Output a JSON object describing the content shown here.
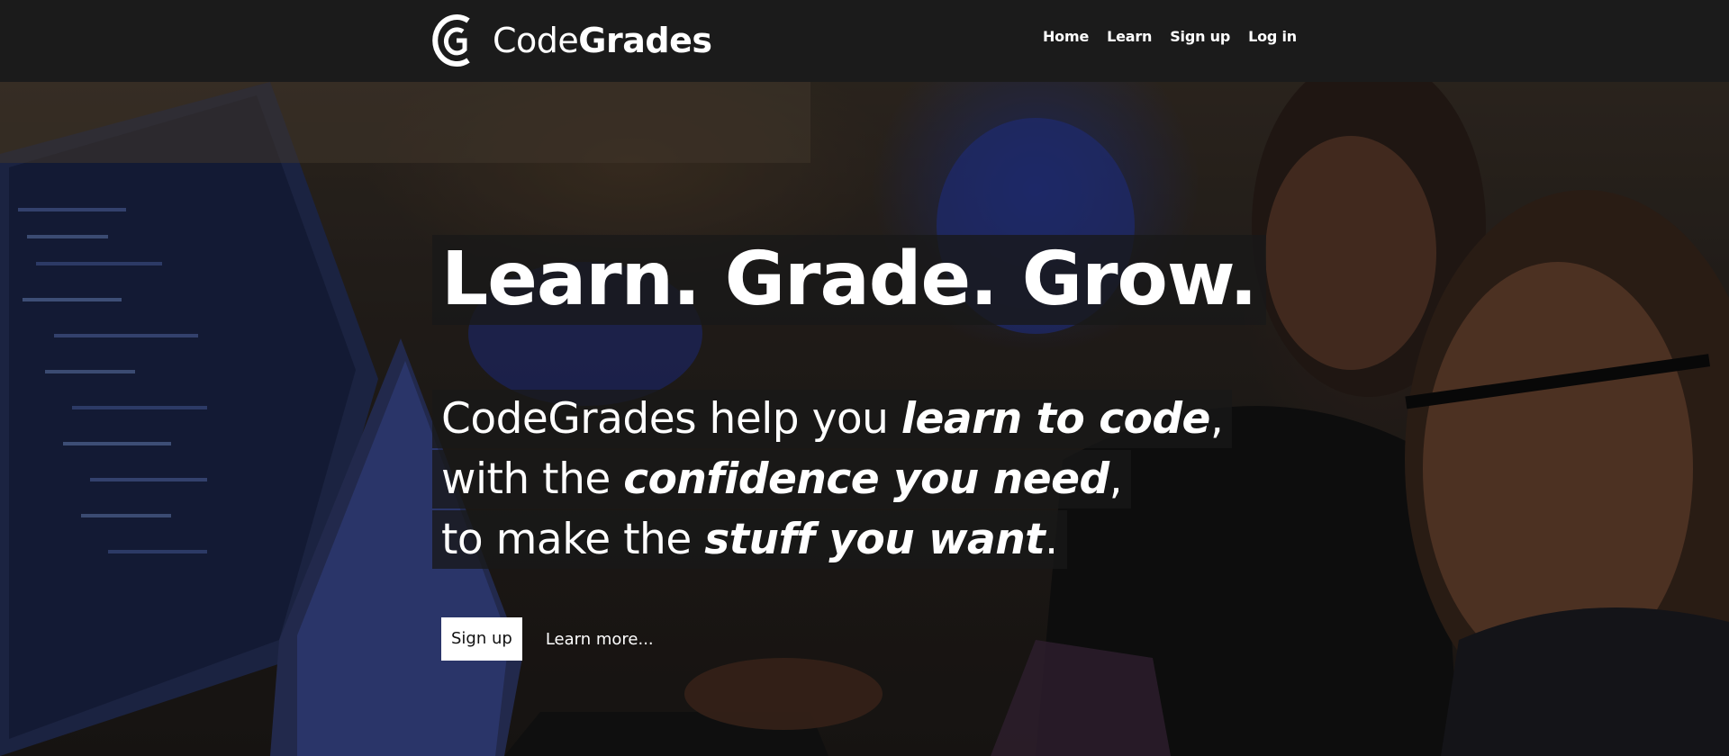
{
  "brand": {
    "name_light": "Code",
    "name_bold": "Grades"
  },
  "nav": {
    "links": [
      {
        "label": "Home"
      },
      {
        "label": "Learn"
      },
      {
        "label": "Sign up"
      },
      {
        "label": "Log in"
      }
    ]
  },
  "hero": {
    "headline": "Learn. Grade. Grow.",
    "tagline": {
      "line1_prefix": "CodeGrades help you ",
      "line1_emph": "learn to code",
      "line1_suffix": ",",
      "line2_prefix": "with the ",
      "line2_emph": "confidence you need",
      "line2_suffix": ",",
      "line3_prefix": "to make the ",
      "line3_emph": "stuff you want",
      "line3_suffix": "."
    },
    "cta_primary": "Sign up",
    "cta_secondary": "Learn more..."
  },
  "colors": {
    "navbar_bg": "#1b1b1b",
    "text": "#ffffff",
    "button_bg": "#ffffff",
    "button_text": "#111111"
  },
  "icons": {
    "logo": "codegrades-logo-icon"
  }
}
